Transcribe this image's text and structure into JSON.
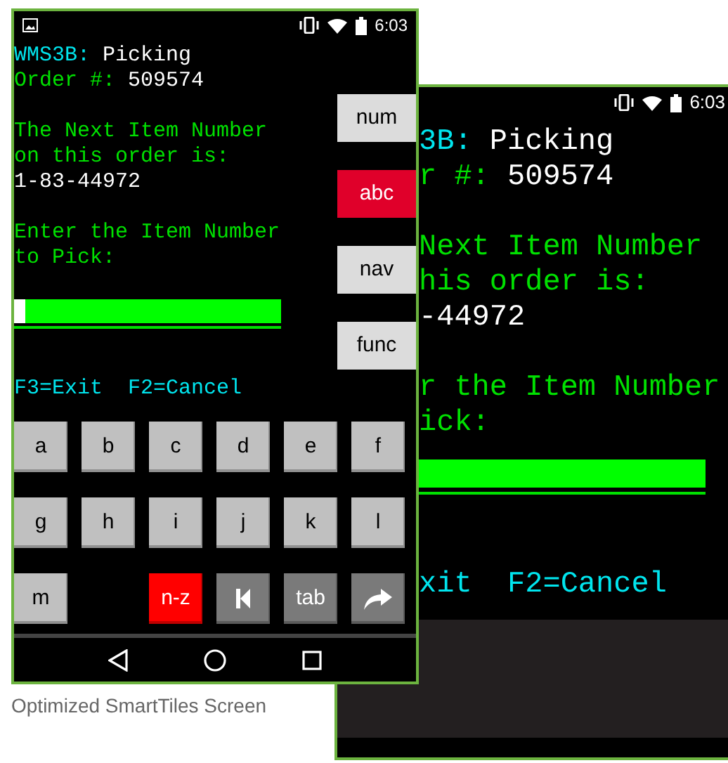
{
  "front_screen": {
    "status_time": "6:03",
    "blocks": [
      [
        [
          {
            "text": "WMS3B:",
            "color": "#00e5ee"
          },
          {
            "text": "Picking",
            "color": "#ffffff"
          }
        ],
        [
          {
            "text": "Order #:",
            "color": "#00e000"
          },
          {
            "text": "509574",
            "color": "#ffffff"
          }
        ]
      ],
      [
        [
          {
            "text": "The Next Item Number",
            "color": "#00e000"
          }
        ],
        [
          {
            "text": "on this order is:",
            "color": "#00e000"
          }
        ],
        [
          {
            "text": "1-83-44972",
            "color": "#ffffff"
          }
        ]
      ],
      [
        [
          {
            "text": "Enter the Item Number",
            "color": "#00e000"
          }
        ],
        [
          {
            "text": "to Pick:",
            "color": "#00e000"
          }
        ]
      ]
    ],
    "function_keys": "F3=Exit  F2=Cancel",
    "side_buttons": [
      {
        "label": "num",
        "selected": false
      },
      {
        "label": "abc",
        "selected": true
      },
      {
        "label": "nav",
        "selected": false
      },
      {
        "label": "func",
        "selected": false
      }
    ],
    "keys": [
      {
        "kind": "letter",
        "label": "a"
      },
      {
        "kind": "letter",
        "label": "b"
      },
      {
        "kind": "letter",
        "label": "c"
      },
      {
        "kind": "letter",
        "label": "d"
      },
      {
        "kind": "letter",
        "label": "e"
      },
      {
        "kind": "letter",
        "label": "f"
      },
      {
        "kind": "letter",
        "label": "g"
      },
      {
        "kind": "letter",
        "label": "h"
      },
      {
        "kind": "letter",
        "label": "i"
      },
      {
        "kind": "letter",
        "label": "j"
      },
      {
        "kind": "letter",
        "label": "k"
      },
      {
        "kind": "letter",
        "label": "l"
      },
      {
        "kind": "letter",
        "label": "m"
      },
      {
        "kind": "blank"
      },
      {
        "kind": "toggle",
        "label": "n-z"
      },
      {
        "kind": "first"
      },
      {
        "kind": "action",
        "label": "tab"
      },
      {
        "kind": "send"
      }
    ]
  },
  "caption": "Optimized SmartTiles Screen",
  "back_screen": {
    "status_time": "6:03",
    "blocks": [
      [
        [
          {
            "text": "3B:",
            "color": "#00e5ee"
          },
          {
            "text": "Picking",
            "color": "#ffffff"
          }
        ],
        [
          {
            "text": "r #:",
            "color": "#00e000"
          },
          {
            "text": "509574",
            "color": "#ffffff"
          }
        ]
      ],
      [
        [
          {
            "text": "Next Item Number",
            "color": "#00e000"
          }
        ],
        [
          {
            "text": "his order is:",
            "color": "#00e000"
          }
        ],
        [
          {
            "text": "-44972",
            "color": "#ffffff"
          }
        ]
      ],
      [
        [
          {
            "text": "r the Item Number",
            "color": "#00e000"
          }
        ],
        [
          {
            "text": "ick:",
            "color": "#00e000"
          }
        ]
      ]
    ],
    "function_keys": "xit  F2=Cancel"
  }
}
